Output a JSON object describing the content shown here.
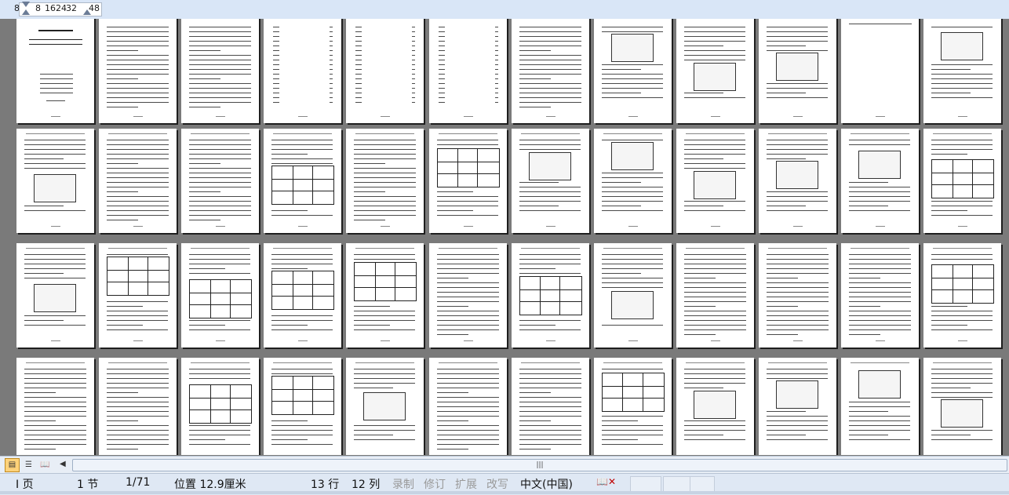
{
  "ruler": {
    "left_margin": "8",
    "ticks": [
      "8",
      "16",
      "24",
      "32",
      "48"
    ]
  },
  "document": {
    "page_count": 48
  },
  "scroll": {
    "grip": "|||"
  },
  "view_buttons": [
    {
      "name": "normal-view-icon",
      "glyph": "▤"
    },
    {
      "name": "outline-view-icon",
      "glyph": "☰"
    },
    {
      "name": "reading-view-icon",
      "glyph": "📖"
    }
  ],
  "status": {
    "page": "I 页",
    "section": "1 节",
    "page_of": "1/71",
    "position": "位置 12.9厘米",
    "line": "13 行",
    "column": "12 列",
    "record": "录制",
    "revise": "修订",
    "extend": "扩展",
    "overwrite": "改写",
    "language": "中文(中国)"
  },
  "colors": {
    "background": "#7a7a7a",
    "ruler": "#d9e6f7",
    "statusbar": "#dfe8f4",
    "active_view": "#ffd27a"
  }
}
